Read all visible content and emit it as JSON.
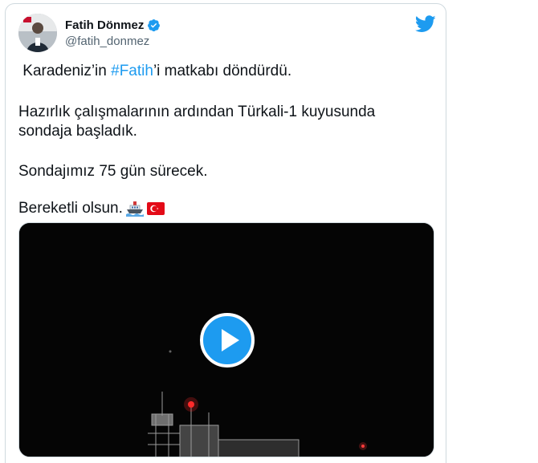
{
  "tweet": {
    "author_name": "Fatih Dönmez",
    "author_handle": "@fatih_donmez",
    "text": {
      "line1_prefix": "Karadeniz’in ",
      "hashtag": "#Fatih",
      "line1_suffix": "’i matkabı döndürdü.",
      "paragraph2": "Hazırlık çalışmalarının ardından Türkali-1 kuyusunda sondaja başladık.",
      "paragraph3": "Sondajımız 75 gün sürecek.",
      "paragraph4": "Bereketli olsun."
    },
    "emojis": [
      "ship-icon",
      "turkey-flag-icon"
    ]
  },
  "media": {
    "type": "video",
    "play_icon": "play-icon"
  },
  "colors": {
    "accent": "#1d9bf0",
    "text": "#0f1419",
    "muted": "#536471",
    "border": "#cfd9de",
    "flag_red": "#e30a17"
  }
}
